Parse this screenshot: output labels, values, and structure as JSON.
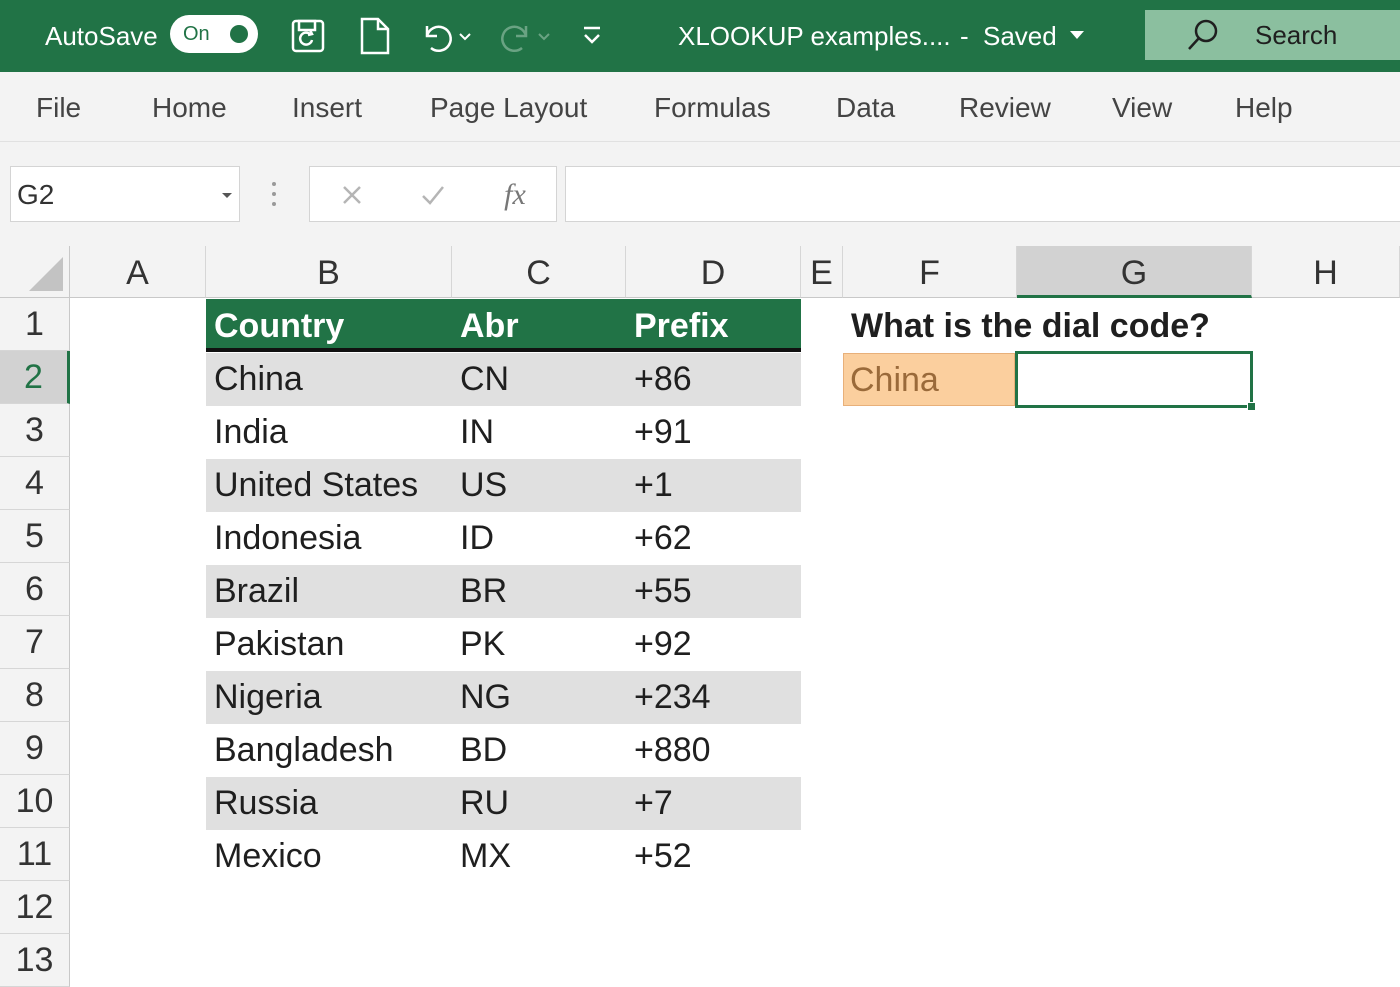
{
  "titlebar": {
    "autosave_label": "AutoSave",
    "autosave_state": "On",
    "document_title": "XLOOKUP examples....",
    "separator": "-",
    "save_status": "Saved",
    "search_label": "Search",
    "accent_color": "#217346"
  },
  "ribbon": {
    "tabs": [
      "File",
      "Home",
      "Insert",
      "Page Layout",
      "Formulas",
      "Data",
      "Review",
      "View",
      "Help"
    ]
  },
  "formula_bar": {
    "name_box": "G2",
    "fx_label": "fx",
    "formula": ""
  },
  "grid": {
    "columns": [
      "A",
      "B",
      "C",
      "D",
      "E",
      "F",
      "G",
      "H"
    ],
    "selected_column": "G",
    "rows": [
      "1",
      "2",
      "3",
      "4",
      "5",
      "6",
      "7",
      "8",
      "9",
      "10",
      "11",
      "12",
      "13"
    ],
    "selected_row": "2"
  },
  "table": {
    "headers": [
      "Country",
      "Abr",
      "Prefix"
    ],
    "rows": [
      [
        "China",
        "CN",
        "+86"
      ],
      [
        "India",
        "IN",
        "+91"
      ],
      [
        "United States",
        "US",
        "+1"
      ],
      [
        "Indonesia",
        "ID",
        "+62"
      ],
      [
        "Brazil",
        "BR",
        "+55"
      ],
      [
        "Pakistan",
        "PK",
        "+92"
      ],
      [
        "Nigeria",
        "NG",
        "+234"
      ],
      [
        "Bangladesh",
        "BD",
        "+880"
      ],
      [
        "Russia",
        "RU",
        "+7"
      ],
      [
        "Mexico",
        "MX",
        "+52"
      ]
    ]
  },
  "lookup": {
    "question": "What is the dial code?",
    "input_value": "China",
    "result_value": ""
  }
}
